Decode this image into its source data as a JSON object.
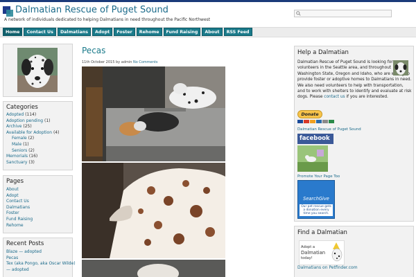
{
  "header": {
    "title": "Dalmatian Rescue of Puget Sound",
    "tagline": "A network of individuals dedicated to helping Dalmatians in need throughout the Pacific Northwest",
    "search_placeholder": ""
  },
  "nav": [
    {
      "label": "Home"
    },
    {
      "label": "Contact Us"
    },
    {
      "label": "Dalmatians"
    },
    {
      "label": "Adopt"
    },
    {
      "label": "Foster"
    },
    {
      "label": "Rehome"
    },
    {
      "label": "Fund Raising"
    },
    {
      "label": "About"
    },
    {
      "label": "RSS Feed"
    }
  ],
  "sidebar": {
    "categories_title": "Categories",
    "categories": [
      {
        "label": "Adopted",
        "count": "(114)"
      },
      {
        "label": "Adoption pending",
        "count": "(1)"
      },
      {
        "label": "Archive",
        "count": "(25)"
      },
      {
        "label": "Available for Adoption",
        "count": "(4)"
      },
      {
        "label": "Female",
        "count": "(2)"
      },
      {
        "label": "Male",
        "count": "(1)"
      },
      {
        "label": "Seniors",
        "count": "(2)"
      },
      {
        "label": "Memorials",
        "count": "(16)"
      },
      {
        "label": "Sanctuary",
        "count": "(3)"
      }
    ],
    "pages_title": "Pages",
    "pages": [
      {
        "label": "About"
      },
      {
        "label": "Adopt"
      },
      {
        "label": "Contact Us"
      },
      {
        "label": "Dalmatians"
      },
      {
        "label": "Foster"
      },
      {
        "label": "Fund Raising"
      },
      {
        "label": "Rehome"
      }
    ],
    "recent_title": "Recent Posts",
    "recent": [
      {
        "label": "Blaze — adopted"
      },
      {
        "label": "Pecas"
      },
      {
        "label": "Tex (aka Pongo, aka Oscar Wilde)"
      },
      {
        "label": "— adopted"
      }
    ]
  },
  "post": {
    "title": "Pecas",
    "meta_date": "11th October 2015 by admin",
    "meta_comments": "No Comments"
  },
  "help": {
    "title": "Help a Dalmatian",
    "text": "Dalmatian Rescue of Puget Sound is looking for volunteers in the Seattle area, and throughout Washington State, Oregon and Idaho, who are willing to provide foster or adoptive homes to Dalmatians in need. We also need volunteers to help with transportation, and to work with shelters to identify and evaluate at risk dogs. Please",
    "contact_link": "contact us",
    "text_end": "if you are interested.",
    "donate_label": "Donate",
    "drps_link": "Dalmatian Rescue of Puget Sound",
    "facebook_label": "facebook",
    "promote_link": "Promote Your Page Too",
    "searchgive_title": "SearchGive",
    "searchgive_text": "Our pet rescue gets a donation every time you search."
  },
  "find": {
    "title": "Find a Dalmatian",
    "adopt_line1": "Adopt a",
    "adopt_line2": "Dalmatian",
    "adopt_line3": "today!",
    "petfinder_link": "Dalmatians on Petfinder.com"
  }
}
